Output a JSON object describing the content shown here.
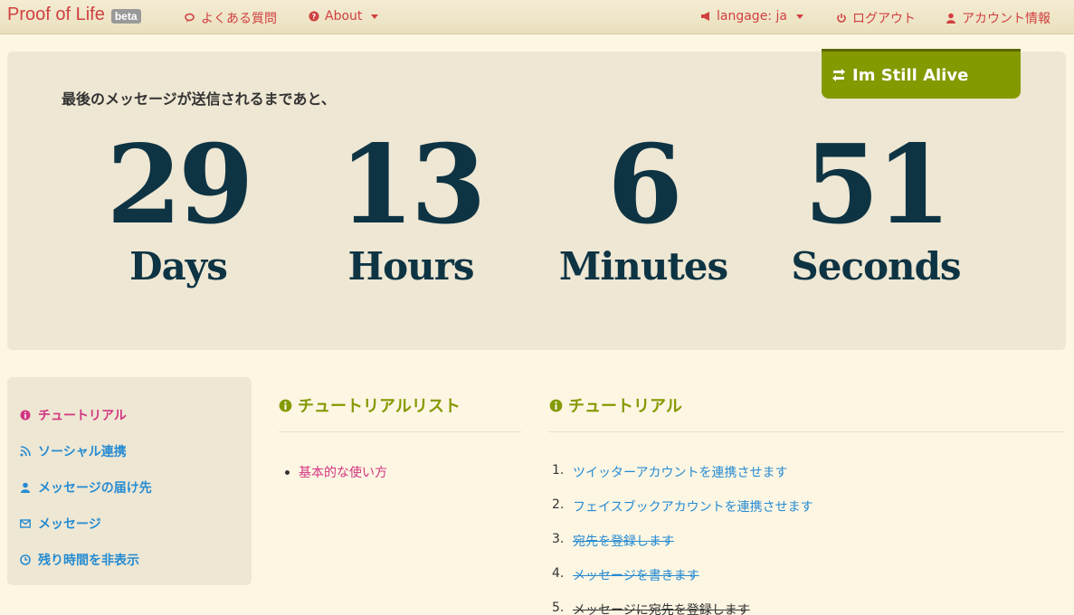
{
  "navbar": {
    "brand": "Proof of Life",
    "badge": "beta",
    "faq": "よくある質問",
    "about": "About",
    "language": "langage: ja",
    "logout": "ログアウト",
    "account": "アカウント情報"
  },
  "hero": {
    "alive_button": "Im Still Alive",
    "lead": "最後のメッセージが送信されるまであと、",
    "countdown": [
      {
        "value": "29",
        "unit": "Days"
      },
      {
        "value": "13",
        "unit": "Hours"
      },
      {
        "value": "6",
        "unit": "Minutes"
      },
      {
        "value": "51",
        "unit": "Seconds"
      }
    ]
  },
  "sidebar": {
    "items": [
      {
        "label": "チュートリアル",
        "icon": "info-icon"
      },
      {
        "label": "ソーシャル連携",
        "icon": "rss-icon"
      },
      {
        "label": "メッセージの届け先",
        "icon": "user-icon"
      },
      {
        "label": "メッセージ",
        "icon": "envelope-icon"
      },
      {
        "label": "残り時間を非表示",
        "icon": "clock-icon"
      }
    ]
  },
  "tutorial_list": {
    "title": "チュートリアルリスト",
    "items": [
      "基本的な使い方"
    ]
  },
  "tutorial": {
    "title": "チュートリアル",
    "steps": [
      {
        "n": "1.",
        "label": "ツイッターアカウントを連携させます"
      },
      {
        "n": "2.",
        "label": "フェイスブックアカウントを連携させます"
      },
      {
        "n": "3.",
        "label": "宛先を登録します"
      },
      {
        "n": "4.",
        "label": "メッセージを書きます"
      },
      {
        "n": "5.",
        "label": "メッセージに宛先を登録します"
      }
    ]
  },
  "colors": {
    "brand": "#d04040",
    "accent_green": "#859900",
    "link_blue": "#268bd2",
    "link_magenta": "#d33682",
    "countdown": "#0e3444"
  }
}
